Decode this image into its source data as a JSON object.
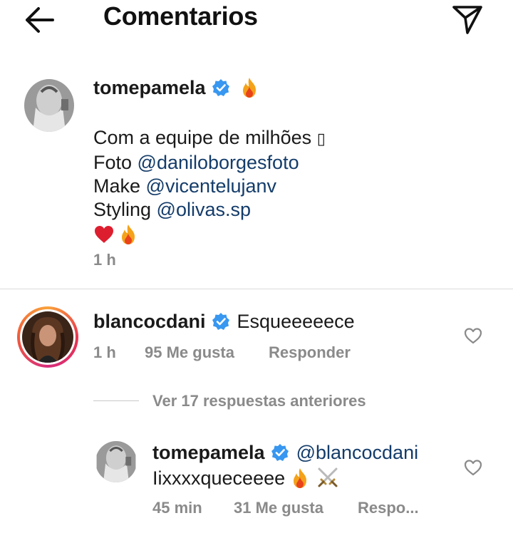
{
  "header": {
    "title": "Comentarios",
    "back_icon": "arrow-left-icon",
    "share_icon": "send-icon"
  },
  "caption": {
    "username": "tomepamela",
    "line1": "Com a equipe de milhões ",
    "line1_glyph": "▯",
    "line2_prefix": "Foto ",
    "line2_mention": "@daniloborgesfoto",
    "line3_prefix": "Make ",
    "line3_mention": "@vicentelujanv",
    "line4_prefix": "Styling ",
    "line4_mention": "@olivas.sp",
    "time": "1 h"
  },
  "comment": {
    "username": "blancocdani",
    "text": "Esqueeeeece",
    "time": "1 h",
    "likes": "95 Me gusta",
    "reply": "Responder"
  },
  "view_replies": "Ver 17 respuestas anteriores",
  "reply": {
    "username": "tomepamela",
    "mention": "@blancocdani",
    "text": "Iixxxxqueceeee",
    "time": "45 min",
    "likes": "31 Me gusta",
    "reply": "Respo..."
  },
  "colors": {
    "mention": "#143c6a",
    "verified": "#3897f0",
    "meta": "#8a8a8a"
  }
}
